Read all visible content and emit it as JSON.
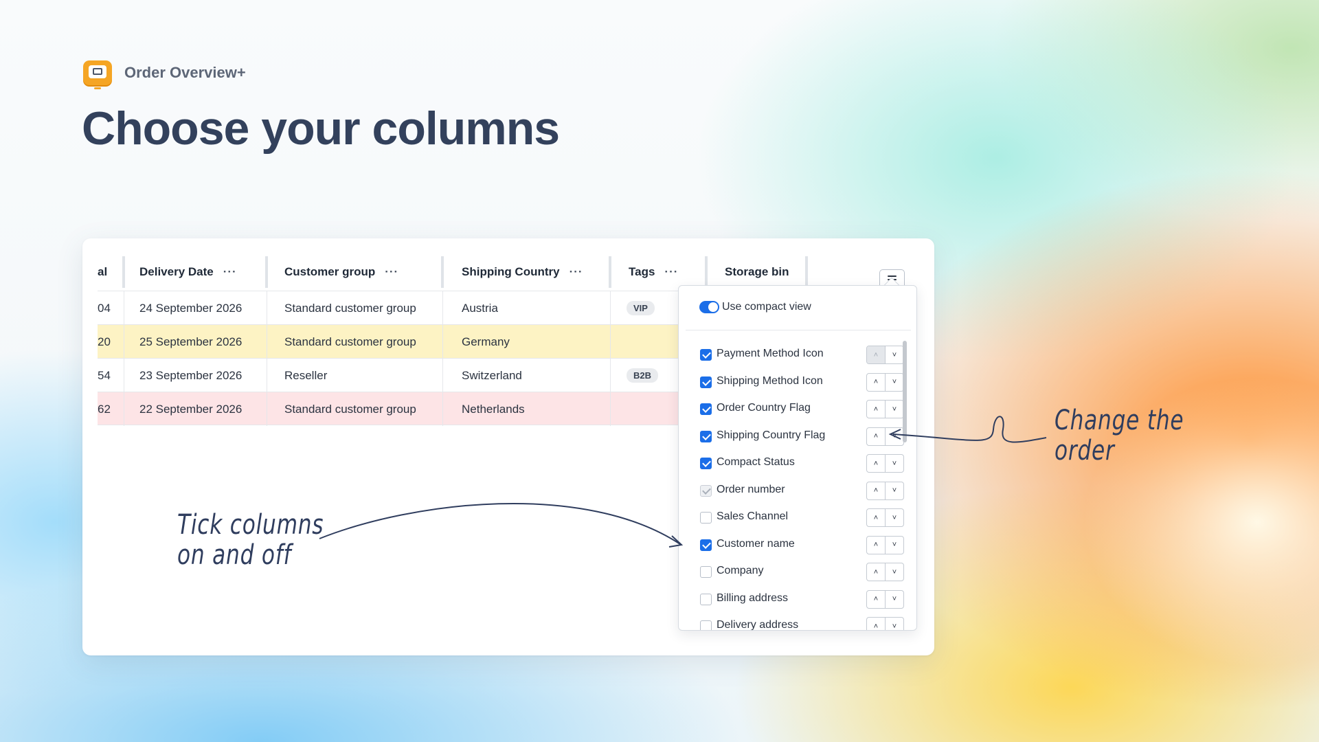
{
  "brand": {
    "name": "Order Overview+",
    "logo_icon": "app-logo-icon"
  },
  "page": {
    "title": "Choose your columns"
  },
  "table": {
    "columns": [
      {
        "label": "al",
        "menu": ""
      },
      {
        "label": "Delivery Date",
        "menu": "···"
      },
      {
        "label": "Customer group",
        "menu": "···"
      },
      {
        "label": "Shipping Country",
        "menu": "···"
      },
      {
        "label": "Tags",
        "menu": "···"
      },
      {
        "label": "Storage bin",
        "menu": ""
      }
    ],
    "columns_button_icon": "hamburger-icon",
    "rows": [
      {
        "col0": "04",
        "delivery": "24 September 2026",
        "group": "Standard customer group",
        "country": "Austria",
        "tag": "VIP",
        "bg": "#ffffff"
      },
      {
        "col0": "20",
        "delivery": "25 September 2026",
        "group": "Standard customer group",
        "country": "Germany",
        "tag": "",
        "bg": "#fdf3c4"
      },
      {
        "col0": "54",
        "delivery": "23 September 2026",
        "group": "Reseller",
        "country": "Switzerland",
        "tag": "B2B",
        "bg": "#ffffff"
      },
      {
        "col0": "62",
        "delivery": "22 September 2026",
        "group": "Standard customer group",
        "country": "Netherlands",
        "tag": "",
        "bg": "#fde4e6"
      }
    ]
  },
  "popover": {
    "toggle_label": "Use compact view",
    "toggle_on": true,
    "options": [
      {
        "label": "Payment Method Icon",
        "state": "on",
        "up_disabled": true
      },
      {
        "label": "Shipping Method Icon",
        "state": "on",
        "up_disabled": false
      },
      {
        "label": "Order Country Flag",
        "state": "on",
        "up_disabled": false
      },
      {
        "label": "Shipping Country Flag",
        "state": "on",
        "up_disabled": false
      },
      {
        "label": "Compact Status",
        "state": "on",
        "up_disabled": false
      },
      {
        "label": "Order number",
        "state": "dim",
        "up_disabled": false
      },
      {
        "label": "Sales Channel",
        "state": "off",
        "up_disabled": false
      },
      {
        "label": "Customer name",
        "state": "on",
        "up_disabled": false
      },
      {
        "label": "Company",
        "state": "off",
        "up_disabled": false
      },
      {
        "label": "Billing address",
        "state": "off",
        "up_disabled": false
      },
      {
        "label": "Delivery address",
        "state": "off",
        "up_disabled": false
      }
    ],
    "up_icon": "chevron-up-icon",
    "down_icon": "chevron-down-icon"
  },
  "annotations": {
    "tick": {
      "line1": "Tick columns",
      "line2": "on and off"
    },
    "order": {
      "line1": "Change the",
      "line2": "order"
    }
  },
  "colors": {
    "accent": "#1b6ee8",
    "title": "#33415c",
    "brand": "#f5a524"
  }
}
